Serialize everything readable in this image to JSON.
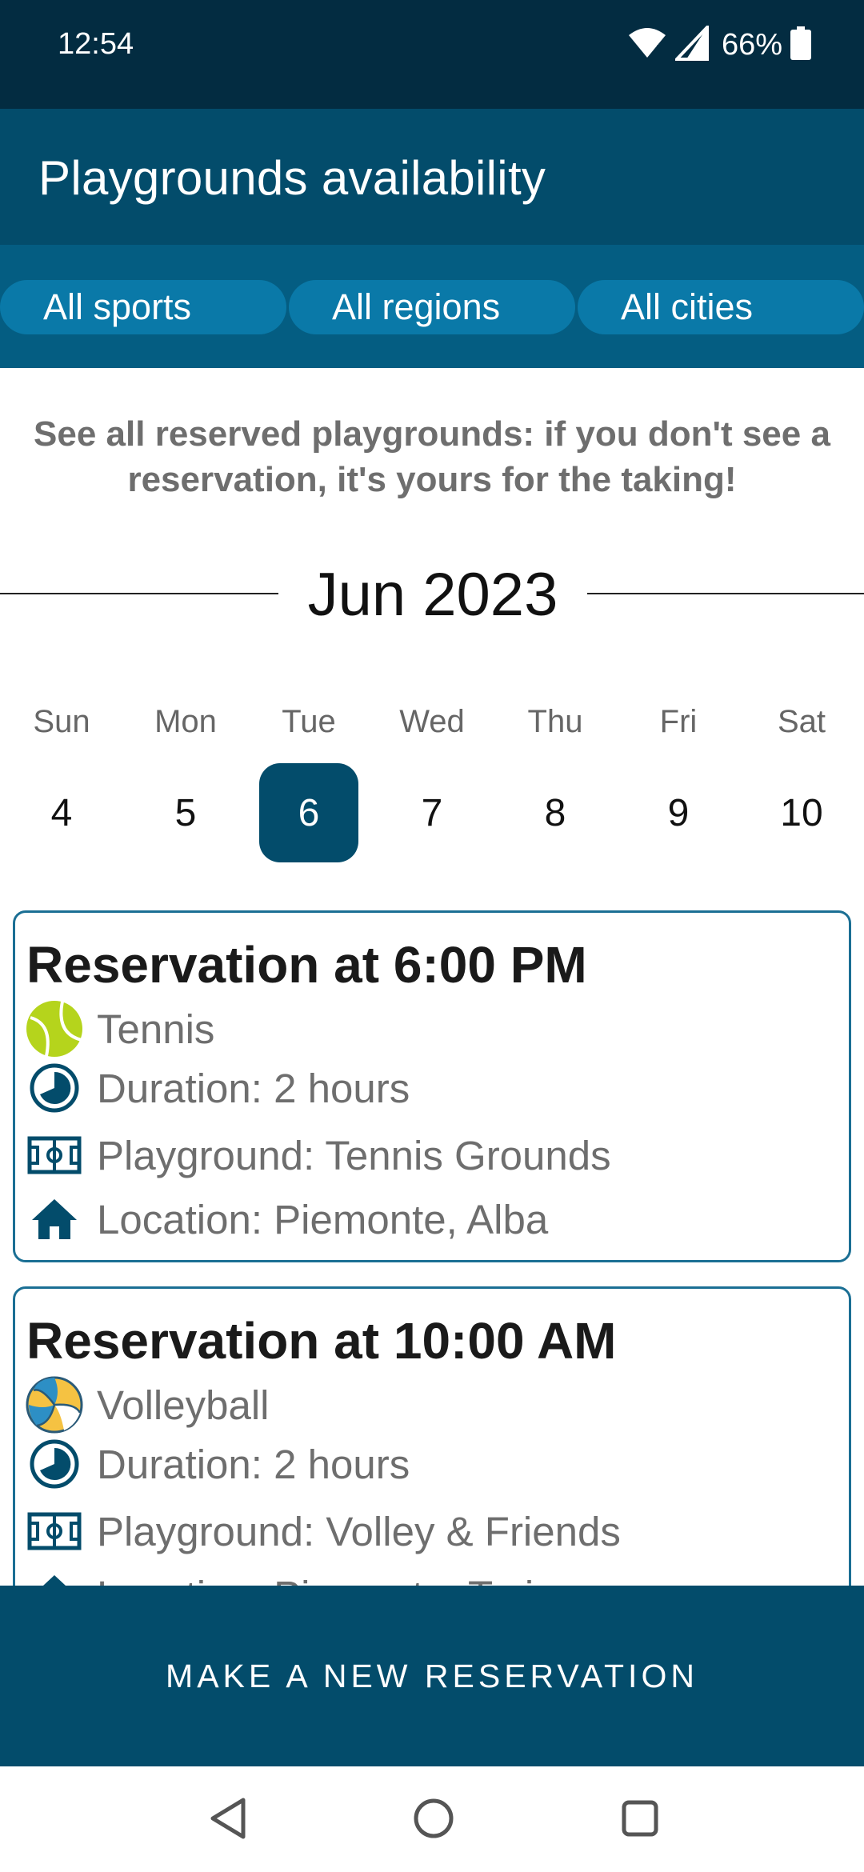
{
  "status_bar": {
    "time": "12:54",
    "battery": "66%"
  },
  "app_bar": {
    "title": "Playgrounds availability"
  },
  "filters": [
    {
      "label": "All sports"
    },
    {
      "label": "All regions"
    },
    {
      "label": "All cities"
    }
  ],
  "hint": "See all reserved playgrounds: if you don't see a reservation, it's yours for the taking!",
  "calendar": {
    "month": "Jun 2023",
    "days": [
      {
        "name": "Sun",
        "num": "4"
      },
      {
        "name": "Mon",
        "num": "5"
      },
      {
        "name": "Tue",
        "num": "6",
        "selected": true
      },
      {
        "name": "Wed",
        "num": "7"
      },
      {
        "name": "Thu",
        "num": "8"
      },
      {
        "name": "Fri",
        "num": "9"
      },
      {
        "name": "Sat",
        "num": "10"
      }
    ]
  },
  "reservations": [
    {
      "title": "Reservation at 6:00 PM",
      "sport": "Tennis",
      "duration": "Duration: 2 hours",
      "playground": "Playground: Tennis Grounds",
      "location": "Location: Piemonte, Alba"
    },
    {
      "title": "Reservation at 10:00 AM",
      "sport": "Volleyball",
      "duration": "Duration: 2 hours",
      "playground": "Playground: Volley & Friends",
      "location": "Location: Piemonte, Torino"
    }
  ],
  "cta": {
    "label": "MAKE A NEW RESERVATION"
  },
  "colors": {
    "status_bar": "#032c41",
    "app_bar": "#034c6b",
    "filter_bar": "#045d82",
    "chip": "#0a79a8",
    "card_border": "#1b6f94",
    "tennis_ball": "#b5d41c"
  },
  "icons": {
    "sport_tennis": "tennis-ball-icon",
    "sport_volleyball": "volleyball-icon",
    "duration": "clock-icon",
    "playground": "field-icon",
    "location": "home-icon"
  }
}
